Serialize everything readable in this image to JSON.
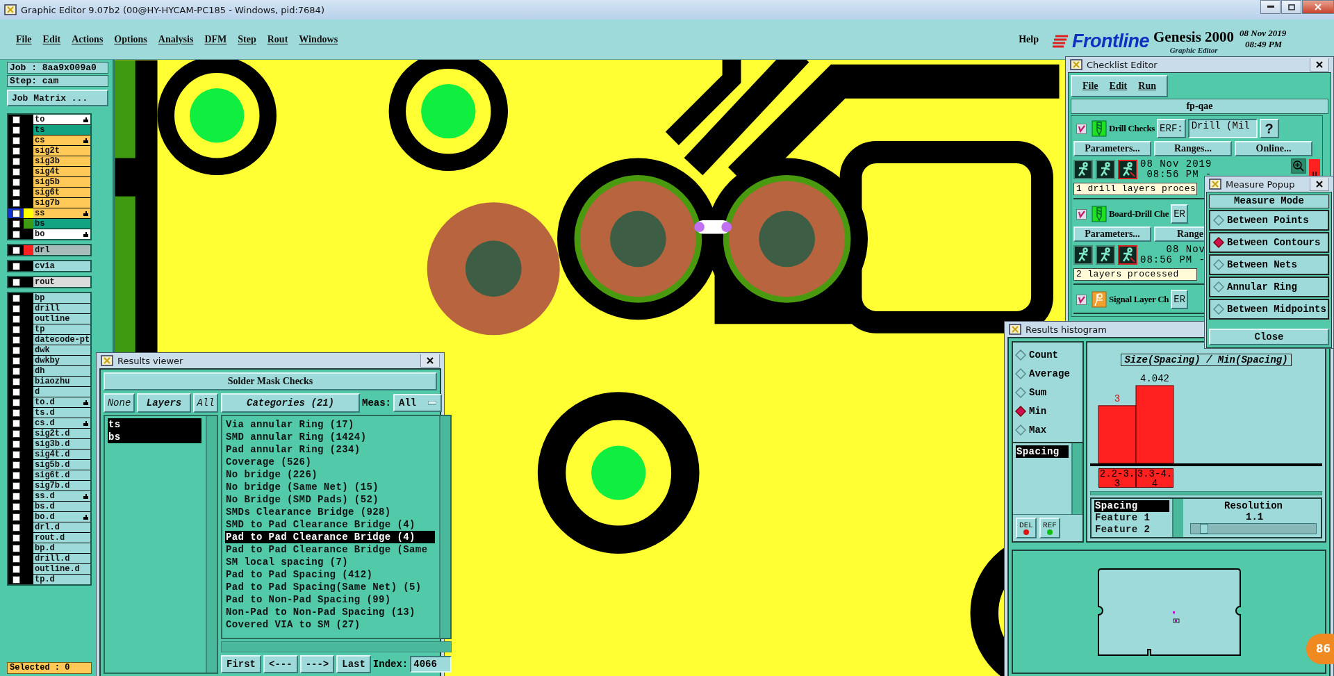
{
  "window": {
    "title": "Graphic Editor 9.07b2 (00@HY-HYCAM-PC185 - Windows, pid:7684)"
  },
  "menu": [
    "File",
    "Edit",
    "Actions",
    "Options",
    "Analysis",
    "DFM",
    "Step",
    "Rout",
    "Windows"
  ],
  "help": "Help",
  "brand": {
    "logo": "Frontline",
    "product": "Genesis 2000",
    "subtitle": "Graphic Editor",
    "date": "08 Nov 2019",
    "time": "08:49 PM"
  },
  "job_panel": {
    "job": "Job : 8aa9x009a0",
    "step": "Step: cam",
    "matrix_button": "Job Matrix ...",
    "selected_count": "Selected : 0",
    "layer_groups": [
      {
        "layers": [
          {
            "name": "to",
            "color": "#ffffff",
            "hand": true,
            "checked": false,
            "selected": false
          },
          {
            "name": "ts",
            "color": "#12a383",
            "hand": false,
            "checked": false,
            "selected": false
          },
          {
            "name": "cs",
            "color": "#ffc857",
            "hand": true,
            "checked": false,
            "selected": false
          },
          {
            "name": "sig2t",
            "color": "#ffc857",
            "hand": false,
            "checked": false,
            "selected": false
          },
          {
            "name": "sig3b",
            "color": "#ffc857",
            "hand": false,
            "checked": false,
            "selected": false
          },
          {
            "name": "sig4t",
            "color": "#ffc857",
            "hand": false,
            "checked": false,
            "selected": false
          },
          {
            "name": "sig5b",
            "color": "#ffc857",
            "hand": false,
            "checked": false,
            "selected": false
          },
          {
            "name": "sig6t",
            "color": "#ffc857",
            "hand": false,
            "checked": false,
            "selected": false
          },
          {
            "name": "sig7b",
            "color": "#ffc857",
            "hand": false,
            "checked": false,
            "selected": false
          },
          {
            "name": "ss",
            "color": "#ffc857",
            "swatch": {
              "color": "#ffff00"
            },
            "hand": true,
            "checked": false,
            "selected": true
          },
          {
            "name": "bs",
            "color": "#12a383",
            "swatch": {
              "color": "#3f9a12"
            },
            "hand": false,
            "checked": false,
            "selected": false
          },
          {
            "name": "bo",
            "color": "#ffffff",
            "hand": true,
            "checked": false,
            "selected": false
          }
        ]
      },
      {
        "layers": [
          {
            "name": "drl",
            "color": "#a9bcbc",
            "swatch": {
              "color": "#ff2020"
            },
            "hand": false,
            "checked": false,
            "selected": false
          }
        ]
      },
      {
        "layers": [
          {
            "name": "cvia",
            "color": "#9fdada",
            "hand": false,
            "checked": false,
            "selected": false
          }
        ]
      },
      {
        "layers": [
          {
            "name": "rout",
            "color": "#dcdcdc",
            "hand": false,
            "checked": false,
            "selected": false
          }
        ]
      },
      {
        "layers": [
          {
            "name": "bp",
            "color": "#9fdada",
            "hand": false,
            "checked": false,
            "selected": false
          },
          {
            "name": "drill",
            "color": "#9fdada",
            "hand": false,
            "checked": false,
            "selected": false
          },
          {
            "name": "outline",
            "color": "#9fdada",
            "hand": false,
            "checked": false,
            "selected": false
          },
          {
            "name": "tp",
            "color": "#9fdada",
            "hand": false,
            "checked": false,
            "selected": false
          },
          {
            "name": "datecode-pt",
            "color": "#9fdada",
            "hand": false,
            "checked": false,
            "selected": false
          },
          {
            "name": "dwk",
            "color": "#9fdada",
            "hand": false,
            "checked": false,
            "selected": false
          },
          {
            "name": "dwkby",
            "color": "#9fdada",
            "hand": false,
            "checked": false,
            "selected": false
          },
          {
            "name": "dh",
            "color": "#9fdada",
            "hand": false,
            "checked": false,
            "selected": false
          },
          {
            "name": "biaozhu",
            "color": "#9fdada",
            "hand": false,
            "checked": false,
            "selected": false
          },
          {
            "name": "d",
            "color": "#9fdada",
            "hand": false,
            "checked": false,
            "selected": false
          },
          {
            "name": "to.d",
            "color": "#9fdada",
            "hand": true,
            "checked": false,
            "selected": false
          },
          {
            "name": "ts.d",
            "color": "#9fdada",
            "hand": false,
            "checked": false,
            "selected": false
          },
          {
            "name": "cs.d",
            "color": "#9fdada",
            "hand": true,
            "checked": false,
            "selected": false
          },
          {
            "name": "sig2t.d",
            "color": "#9fdada",
            "hand": false,
            "checked": false,
            "selected": false
          },
          {
            "name": "sig3b.d",
            "color": "#9fdada",
            "hand": false,
            "checked": false,
            "selected": false
          },
          {
            "name": "sig4t.d",
            "color": "#9fdada",
            "hand": false,
            "checked": false,
            "selected": false
          },
          {
            "name": "sig5b.d",
            "color": "#9fdada",
            "hand": false,
            "checked": false,
            "selected": false
          },
          {
            "name": "sig6t.d",
            "color": "#9fdada",
            "hand": false,
            "checked": false,
            "selected": false
          },
          {
            "name": "sig7b.d",
            "color": "#9fdada",
            "hand": false,
            "checked": false,
            "selected": false
          },
          {
            "name": "ss.d",
            "color": "#9fdada",
            "hand": true,
            "checked": false,
            "selected": false
          },
          {
            "name": "bs.d",
            "color": "#9fdada",
            "hand": false,
            "checked": false,
            "selected": false
          },
          {
            "name": "bo.d",
            "color": "#9fdada",
            "hand": true,
            "checked": false,
            "selected": false
          },
          {
            "name": "drl.d",
            "color": "#9fdada",
            "hand": false,
            "checked": false,
            "selected": false
          },
          {
            "name": "rout.d",
            "color": "#9fdada",
            "hand": false,
            "checked": false,
            "selected": false
          },
          {
            "name": "bp.d",
            "color": "#9fdada",
            "hand": false,
            "checked": false,
            "selected": false
          },
          {
            "name": "drill.d",
            "color": "#9fdada",
            "hand": false,
            "checked": false,
            "selected": false
          },
          {
            "name": "outline.d",
            "color": "#9fdada",
            "hand": false,
            "checked": false,
            "selected": false
          },
          {
            "name": "tp.d",
            "color": "#9fdada",
            "hand": false,
            "checked": false,
            "selected": false
          }
        ]
      }
    ]
  },
  "results_viewer": {
    "title": "Results viewer",
    "header": "Solder Mask Checks",
    "layer_buttons": [
      "None",
      "Layers",
      "All"
    ],
    "layers": [
      {
        "name": "ts",
        "selected": true
      },
      {
        "name": "bs",
        "selected": true
      }
    ],
    "categories_button": "Categories (21)",
    "meas_label": "Meas:",
    "meas_value": "All",
    "categories": [
      {
        "name": "Via annular Ring (17)",
        "selected": false
      },
      {
        "name": "SMD annular Ring (1424)",
        "selected": false
      },
      {
        "name": "Pad annular Ring (234)",
        "selected": false
      },
      {
        "name": "Coverage (526)",
        "selected": false
      },
      {
        "name": "No bridge (226)",
        "selected": false
      },
      {
        "name": "No bridge (Same Net) (15)",
        "selected": false
      },
      {
        "name": "No Bridge (SMD Pads) (52)",
        "selected": false
      },
      {
        "name": "SMDs Clearance Bridge (928)",
        "selected": false
      },
      {
        "name": "SMD to Pad Clearance Bridge (4)",
        "selected": false
      },
      {
        "name": "Pad to Pad Clearance Bridge (4)",
        "selected": true
      },
      {
        "name": "Pad to Pad Clearance Bridge (Same",
        "selected": false
      },
      {
        "name": "SM local spacing (7)",
        "selected": false
      },
      {
        "name": "Pad to Pad Spacing (412)",
        "selected": false
      },
      {
        "name": "Pad to Pad Spacing(Same Net) (5)",
        "selected": false
      },
      {
        "name": "Pad to Non-Pad Spacing (99)",
        "selected": false
      },
      {
        "name": "Non-Pad to Non-Pad Spacing (13)",
        "selected": false
      },
      {
        "name": "Covered VIA to SM (27)",
        "selected": false
      }
    ],
    "nav_buttons": [
      "First",
      "<---",
      "--->",
      "Last"
    ],
    "index_label": "Index:",
    "index_value": "4066"
  },
  "checklist_editor": {
    "title": "Checklist Editor",
    "menu": [
      "File",
      "Edit",
      "Run"
    ],
    "name": "fp-qae",
    "checks": [
      {
        "name": "Drill Checks",
        "checked": true,
        "kind": "drill",
        "erf_label": "ERF:",
        "erf_value": "Drill (Mil",
        "help_button": "?",
        "buttons": [
          "Parameters...",
          "Ranges...",
          "Online..."
        ],
        "date": "08 Nov 2019",
        "time": "08:56 PM -",
        "status": "1 drill layers proces"
      },
      {
        "name": "Board-Drill Che",
        "checked": true,
        "kind": "drill",
        "erf_label": "ER",
        "buttons": [
          "Parameters...",
          "Range"
        ],
        "date": "08 Nov",
        "time": "08:56 PM -",
        "status": "2 layers processed"
      },
      {
        "name": "Signal Layer Ch",
        "checked": true,
        "kind": "signal",
        "erf_label": "ER"
      }
    ]
  },
  "measure_popup": {
    "title": "Measure Popup",
    "header": "Measure Mode",
    "modes": [
      {
        "label": "Between Points",
        "selected": false
      },
      {
        "label": "Between Contours",
        "selected": true
      },
      {
        "label": "Between Nets",
        "selected": false
      },
      {
        "label": "Annular Ring",
        "selected": false
      },
      {
        "label": "Between Midpoints",
        "selected": false
      }
    ],
    "close_button": "Close"
  },
  "histogram": {
    "title": "Results histogram",
    "modes": [
      {
        "label": "Count",
        "selected": false
      },
      {
        "label": "Average",
        "selected": false
      },
      {
        "label": "Sum",
        "selected": false
      },
      {
        "label": "Min",
        "selected": true
      },
      {
        "label": "Max",
        "selected": false
      }
    ],
    "measures": [
      {
        "label": "Spacing",
        "selected": true
      }
    ],
    "del_button": "DEL",
    "ref_button": "REF",
    "chart_data": {
      "type": "bar",
      "title": "Size(Spacing) / Min(Spacing)",
      "categories": [
        "2.2-3.3",
        "3.3-4.4"
      ],
      "values": [
        3,
        4.042
      ],
      "data_labels": true
    },
    "features": [
      {
        "label": "Spacing",
        "selected": true
      },
      {
        "label": "Feature 1",
        "selected": false
      },
      {
        "label": "Feature 2",
        "selected": false
      }
    ],
    "resolution_label": "Resolution",
    "resolution_value": "1.1",
    "resolution_slider": {
      "level": 0.1
    }
  },
  "badge": "86"
}
